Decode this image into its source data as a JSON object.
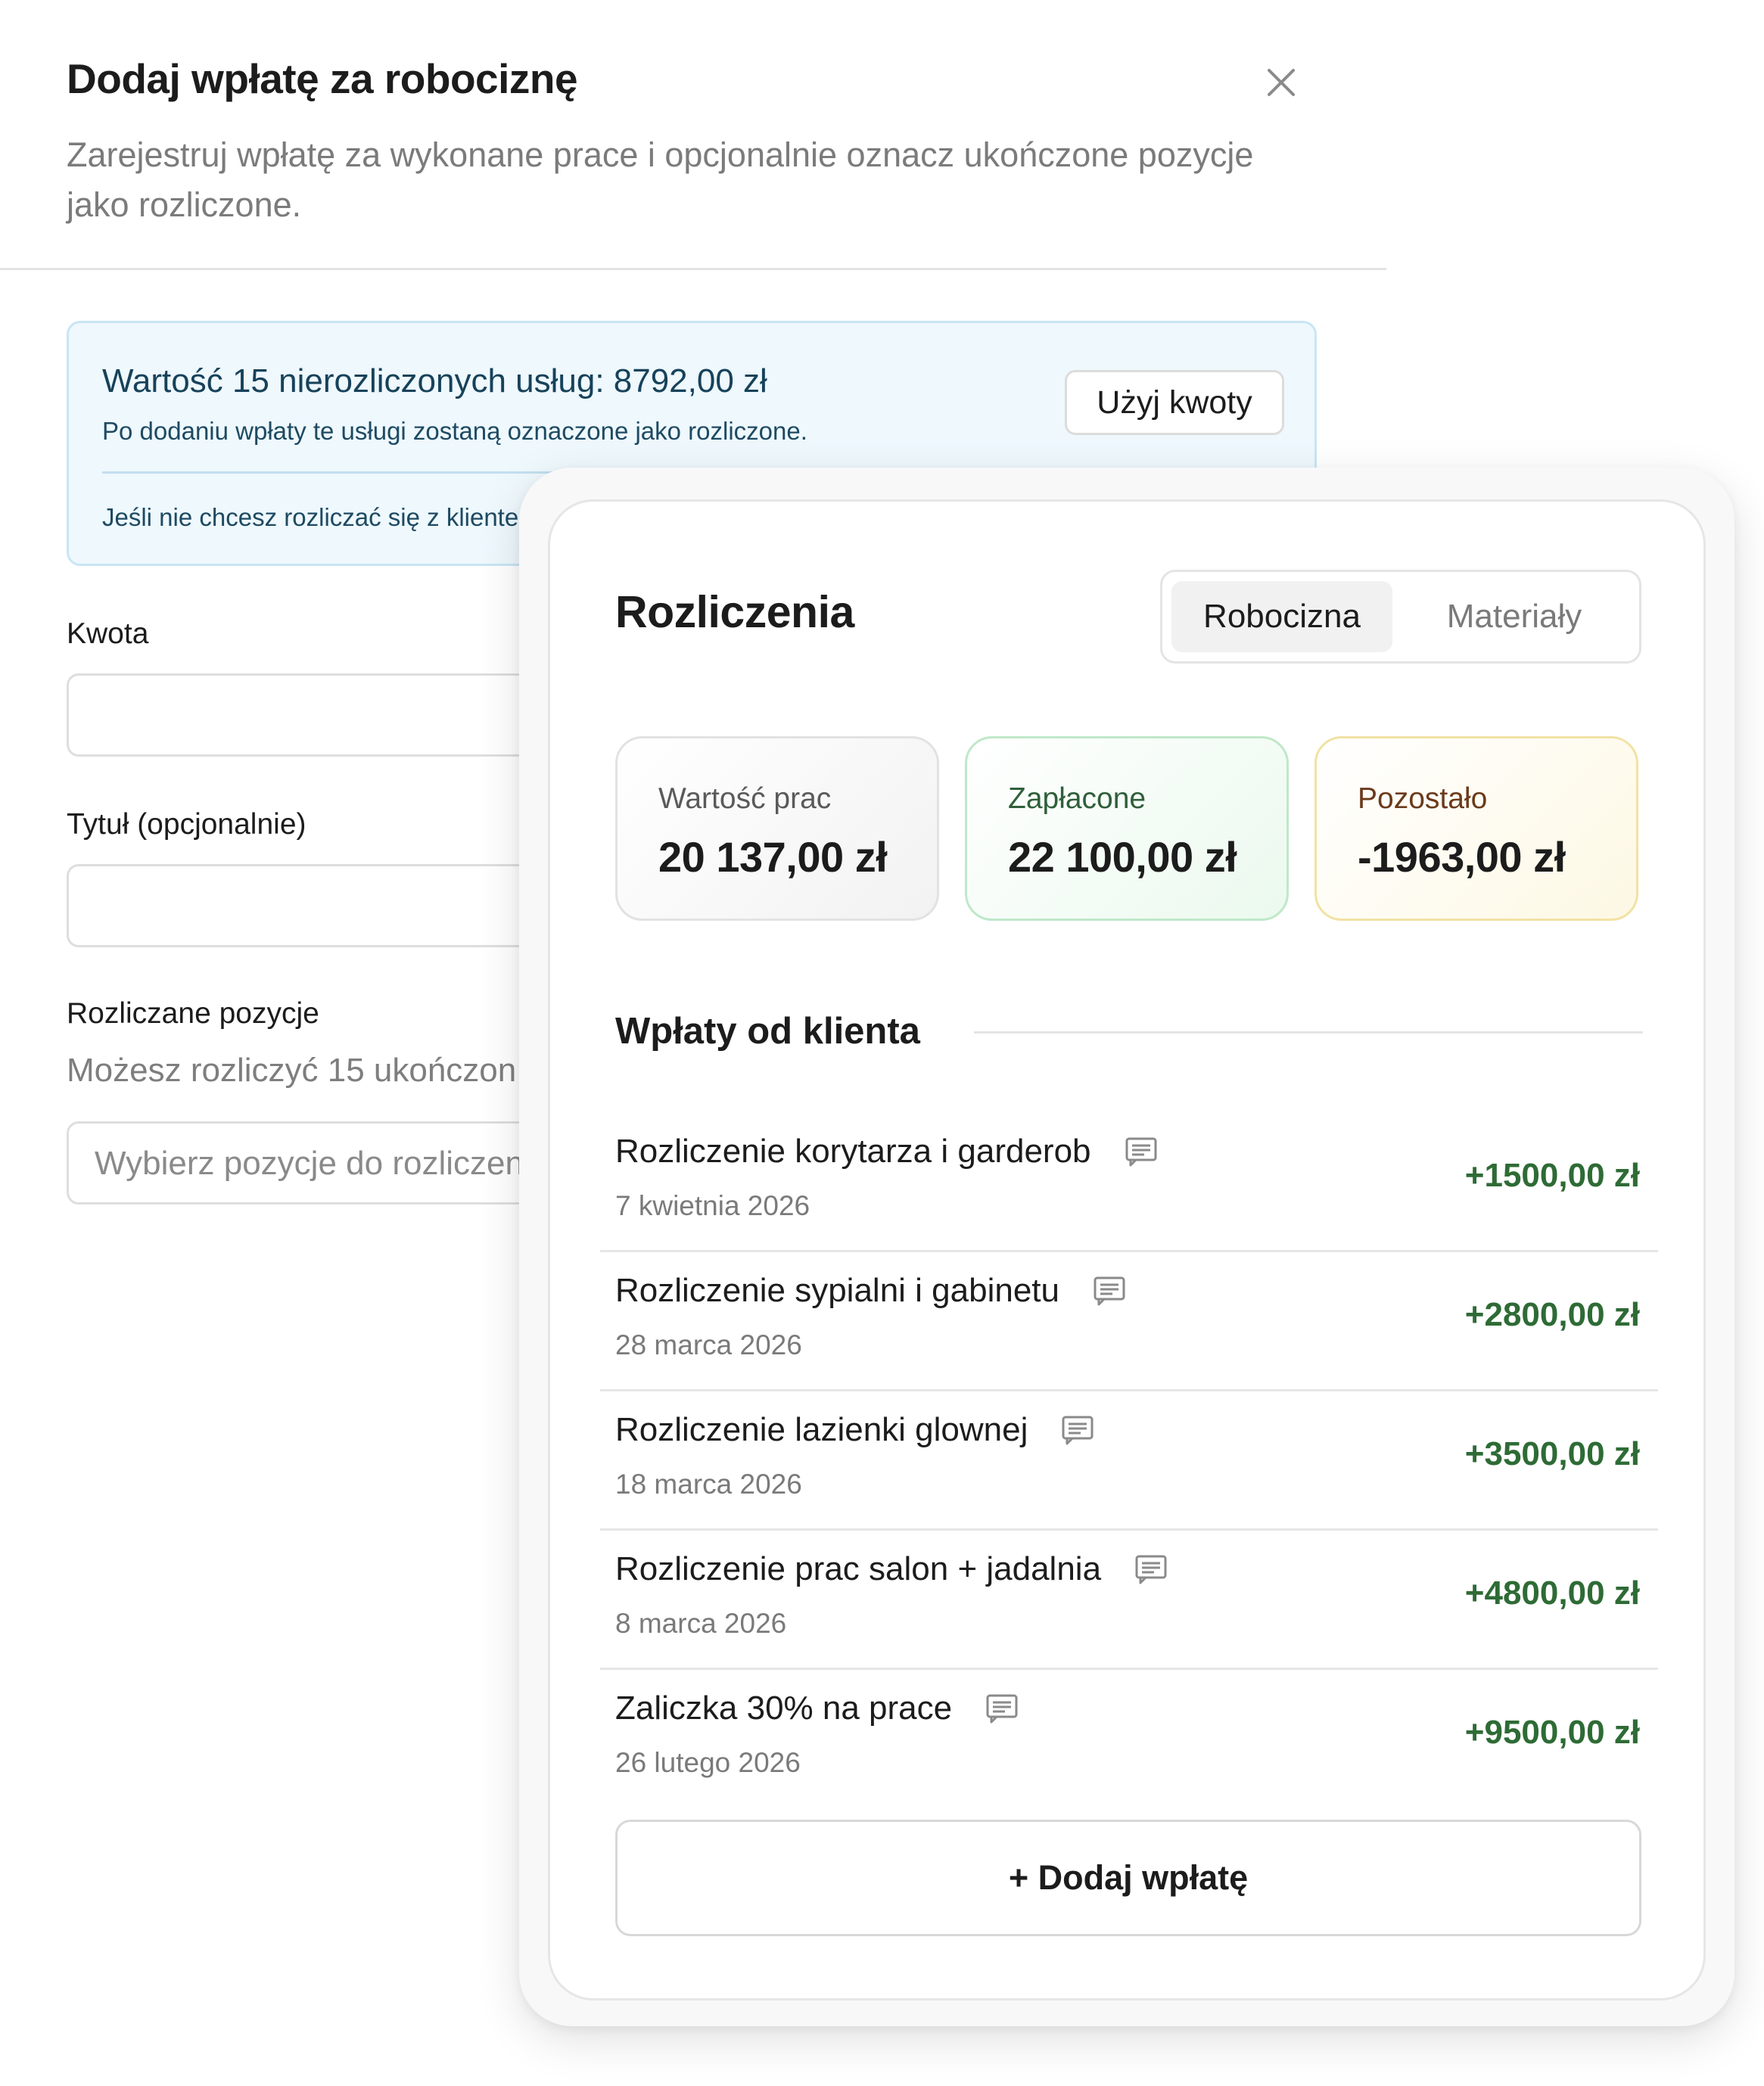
{
  "dialog": {
    "title": "Dodaj wpłatę za robociznę",
    "subtitle": "Zarejestruj wpłatę za wykonane prace i opcjonalnie oznacz ukończone pozycje jako rozliczone.",
    "info": {
      "title": "Wartość 15 nierozliczonych usług: 8792,00 zł",
      "description": "Po dodaniu wpłaty te usługi zostaną oznaczone jako rozliczone.",
      "note": "Jeśli nie chcesz rozliczać się z kliente",
      "use_amount_label": "Użyj kwoty"
    },
    "amount_label": "Kwota",
    "title_label": "Tytuł (opcjonalnie)",
    "items_label": "Rozliczane pozycje",
    "items_hint": "Możesz rozliczyć 15 ukończon",
    "items_placeholder": "Wybierz pozycje do rozliczen"
  },
  "panel": {
    "title": "Rozliczenia",
    "tabs": [
      "Robocizna",
      "Materiały"
    ],
    "active_tab": "Robocizna",
    "stats": [
      {
        "label": "Wartość prac",
        "value": "20 137,00 zł"
      },
      {
        "label": "Zapłacone",
        "value": "22 100,00 zł"
      },
      {
        "label": "Pozostało",
        "value": "-1963,00 zł"
      }
    ],
    "payments_title": "Wpłaty od klienta",
    "payments": [
      {
        "title": "Rozliczenie korytarza i garderob",
        "date": "7 kwietnia 2026",
        "amount": "+1500,00 zł"
      },
      {
        "title": "Rozliczenie sypialni i gabinetu",
        "date": "28 marca 2026",
        "amount": "+2800,00 zł"
      },
      {
        "title": "Rozliczenie lazienki glownej",
        "date": "18 marca 2026",
        "amount": "+3500,00 zł"
      },
      {
        "title": "Rozliczenie prac salon + jadalnia",
        "date": "8 marca 2026",
        "amount": "+4800,00 zł"
      },
      {
        "title": "Zaliczka 30% na prace",
        "date": "26 lutego 2026",
        "amount": "+9500,00 zł"
      }
    ],
    "add_payment_label": "+ Dodaj wpłatę"
  },
  "colors": {
    "paid_amount": "#2e6b35",
    "info_bg": "#eef8fd",
    "info_border": "#c9e6f4",
    "paid_card_border": "#bfe8c8",
    "remaining_card_border": "#f1e2a4"
  },
  "icons": {
    "close": "close-icon",
    "note": "note-icon"
  }
}
